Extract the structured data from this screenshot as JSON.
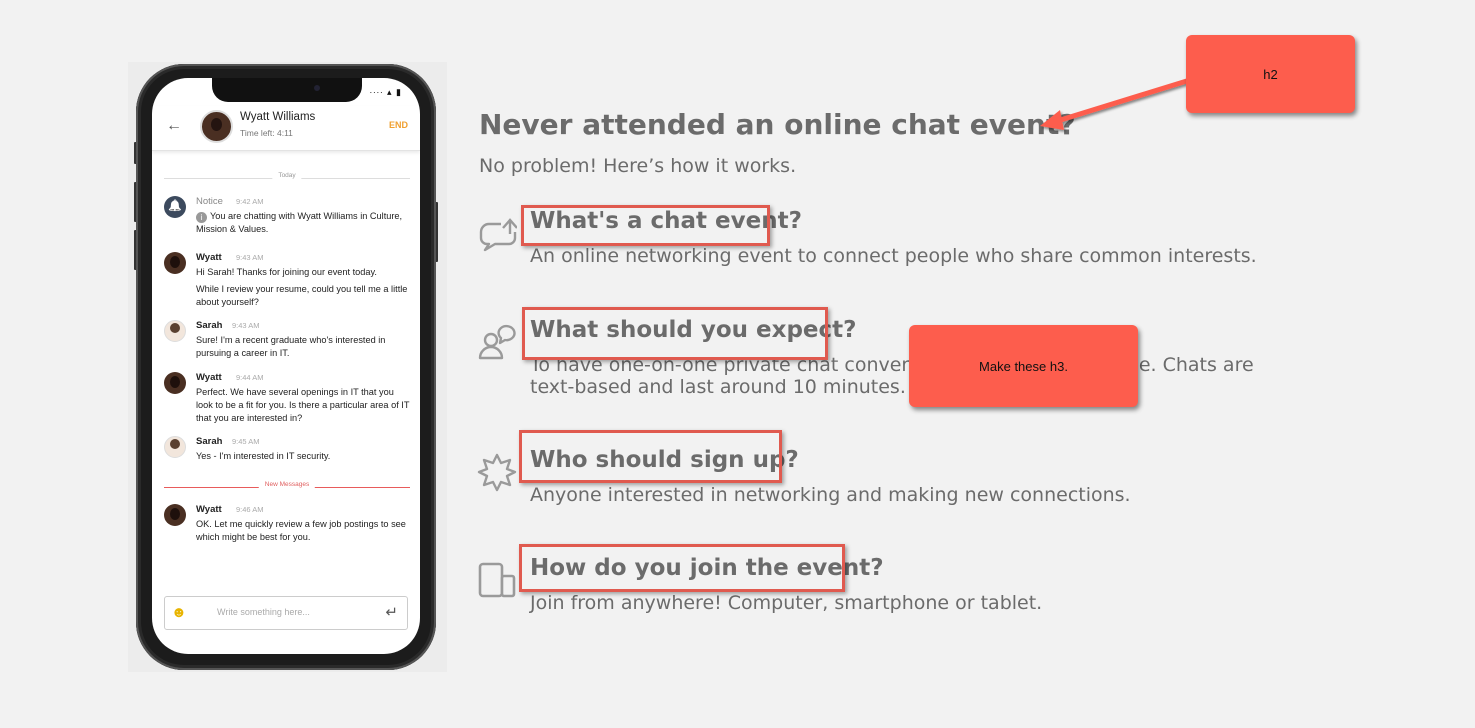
{
  "phone": {
    "status_icons": "∙∙∙∙ ▴ ▮",
    "header": {
      "back_icon": "←",
      "name": "Wyatt Williams",
      "time_left": "Time left:  4:11",
      "end_label": "END"
    },
    "day_label": "Today",
    "messages": [
      {
        "sender": "Notice",
        "time": "9:42 AM",
        "text": "You are chatting with Wyatt Williams in Culture, Mission & Values.",
        "avatar": "bell-icon"
      },
      {
        "sender": "Wyatt",
        "time": "9:43 AM",
        "text": "Hi Sarah! Thanks for joining our event today.",
        "text2": "While I review your resume, could you tell me a little about yourself?"
      },
      {
        "sender": "Sarah",
        "time": "9:43 AM",
        "text": "Sure! I'm a recent graduate who's interested in pursuing a career in IT."
      },
      {
        "sender": "Wyatt",
        "time": "9:44 AM",
        "text": "Perfect. We have several openings in IT that you look to be a fit for you. Is there a particular area of IT that you are interested in?"
      },
      {
        "sender": "Sarah",
        "time": "9:45 AM",
        "text": "Yes - I'm interested in IT security."
      },
      {
        "sender": "Wyatt",
        "time": "9:46 AM",
        "text": "OK. Let me quickly review a few job postings to see which might be best for you."
      }
    ],
    "new_messages_label": "New Messages",
    "composer": {
      "placeholder": "Write something here...",
      "emoji_icon": "☻",
      "send_icon": "↵"
    }
  },
  "content": {
    "title": "Never attended an online chat event?",
    "subtitle": "No problem! Here’s how it works.",
    "items": [
      {
        "icon": "chat-bubble-arrow-icon",
        "title": "What's a chat event?",
        "desc": "An online networking event to connect people who share common interests."
      },
      {
        "icon": "person-speech-icon",
        "title": "What should you expect?",
        "desc": "To have one-on-one private chat conversations with other people. Chats are text-based and last around 10 minutes."
      },
      {
        "icon": "puzzle-star-icon",
        "title": "Who should sign up?",
        "desc": "Anyone interested in networking and making new connections."
      },
      {
        "icon": "devices-icon",
        "title": "How do you join the event?",
        "desc": "Join from anywhere! Computer, smartphone or tablet."
      }
    ]
  },
  "annotations": {
    "h2_callout": "h2",
    "h3_callout": "Make these h3.",
    "color": "#fd5d4d",
    "highlight_color": "#e05a4f"
  }
}
